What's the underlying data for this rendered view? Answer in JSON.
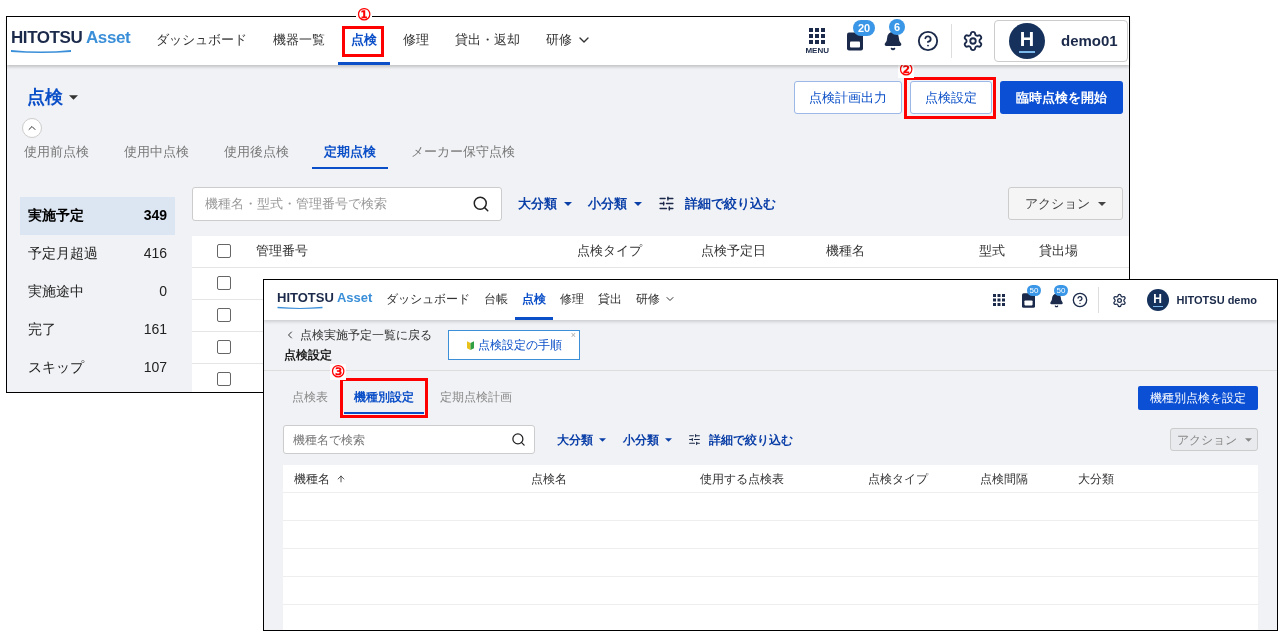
{
  "main_screen": {
    "logo": {
      "brand": "HITOTSU",
      "product": "Asset"
    },
    "nav": [
      {
        "label": "ダッシュボード",
        "selected": false,
        "kind": "link"
      },
      {
        "label": "機器一覧",
        "selected": false,
        "kind": "link"
      },
      {
        "label": "点検",
        "selected": true,
        "kind": "link",
        "annotation": "①"
      },
      {
        "label": "修理",
        "selected": false,
        "kind": "link"
      },
      {
        "label": "貸出・返却",
        "selected": false,
        "kind": "link"
      },
      {
        "label": "研修",
        "selected": false,
        "kind": "dropdown"
      }
    ],
    "menu_label": "MENU",
    "pda_badge": "20",
    "notification_badge": "6",
    "user": {
      "initial": "H",
      "name": "demo01"
    },
    "page_title": "点検",
    "buttons": [
      {
        "label": "点検計画出力",
        "kind": "outline"
      },
      {
        "label": "点検設定",
        "kind": "outline",
        "annotation": "②"
      },
      {
        "label": "臨時点検を開始",
        "kind": "primary"
      }
    ],
    "tabs": [
      {
        "label": "使用前点検",
        "selected": false
      },
      {
        "label": "使用中点検",
        "selected": false
      },
      {
        "label": "使用後点検",
        "selected": false
      },
      {
        "label": "定期点検",
        "selected": true
      },
      {
        "label": "メーカー保守点検",
        "selected": false
      }
    ],
    "status_list": [
      {
        "label": "実施予定",
        "count": "349",
        "selected": true
      },
      {
        "label": "予定月超過",
        "count": "416",
        "selected": false
      },
      {
        "label": "実施途中",
        "count": "0",
        "selected": false
      },
      {
        "label": "完了",
        "count": "161",
        "selected": false
      },
      {
        "label": "スキップ",
        "count": "107",
        "selected": false
      }
    ],
    "search": {
      "placeholder": "機種名・型式・管理番号で検索"
    },
    "filters": [
      "大分類",
      "小分類"
    ],
    "detail_filter": "詳細で絞り込む",
    "action_button": "アクション",
    "table": {
      "header_checked": false,
      "columns": [
        "管理番号",
        "点検タイプ",
        "点検予定日",
        "機種名",
        "型式",
        "貸出場"
      ],
      "rows": [
        {
          "checked": false
        },
        {
          "checked": false
        },
        {
          "checked": false
        },
        {
          "checked": false
        }
      ]
    }
  },
  "settings_screen": {
    "logo": {
      "brand": "HITOTSU",
      "product": "Asset"
    },
    "nav": [
      {
        "label": "ダッシュボード",
        "selected": false,
        "kind": "link"
      },
      {
        "label": "台帳",
        "selected": false,
        "kind": "link"
      },
      {
        "label": "点検",
        "selected": true,
        "kind": "link"
      },
      {
        "label": "修理",
        "selected": false,
        "kind": "link"
      },
      {
        "label": "貸出",
        "selected": false,
        "kind": "link"
      },
      {
        "label": "研修",
        "selected": false,
        "kind": "dropdown"
      }
    ],
    "pda_badge": "50",
    "notification_badge": "50",
    "user": {
      "initial": "H",
      "name": "HITOTSU demo"
    },
    "back_link": "点検実施予定一覧に戻る",
    "page_title": "点検設定",
    "guide_card": {
      "label": "点検設定の手順",
      "close": "×"
    },
    "tabs": [
      {
        "label": "点検表",
        "selected": false
      },
      {
        "label": "機種別設定",
        "selected": true,
        "annotation": "③"
      },
      {
        "label": "定期点検計画",
        "selected": false
      }
    ],
    "primary_button": "機種別点検を設定",
    "search": {
      "placeholder": "機種名で検索"
    },
    "filters": [
      "大分類",
      "小分類"
    ],
    "detail_filter": "詳細で絞り込む",
    "action_button": {
      "label": "アクション",
      "disabled": true
    },
    "table": {
      "columns": [
        {
          "label": "機種名",
          "sorted_ascending": true
        },
        {
          "label": "点検名",
          "sorted_ascending": false
        },
        {
          "label": "使用する点検表",
          "sorted_ascending": false
        },
        {
          "label": "点検タイプ",
          "sorted_ascending": false
        },
        {
          "label": "点検間隔",
          "sorted_ascending": false
        },
        {
          "label": "大分類",
          "sorted_ascending": false
        }
      ]
    }
  }
}
